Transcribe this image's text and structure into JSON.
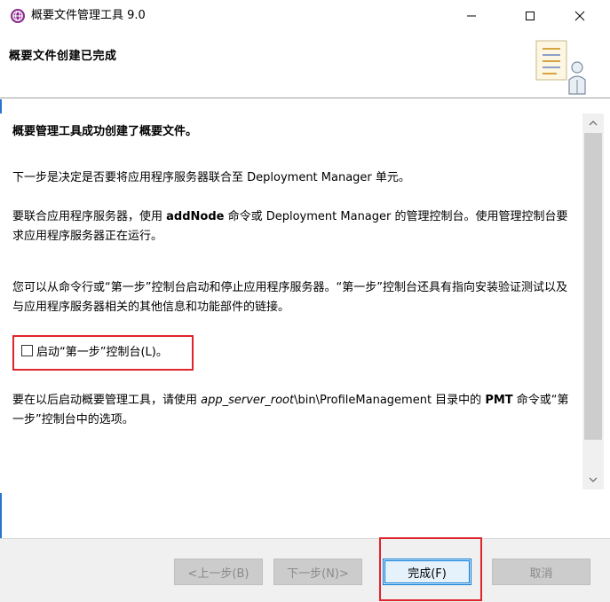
{
  "window": {
    "title": "概要文件管理工具 9.0"
  },
  "header": {
    "title": "概要文件创建已完成",
    "graphic_icon": "document-with-person-icon"
  },
  "content": {
    "heading": "概要管理工具成功创建了概要文件。",
    "p1": "下一步是决定是否要将应用程序服务器联合至 Deployment Manager 单元。",
    "p2_before": " 要联合应用程序服务器，使用 ",
    "p2_bold": "addNode",
    "p2_after": " 命令或 Deployment Manager 的管理控制台。使用管理控制台要求应用程序服务器正在运行。",
    "p3": "您可以从命令行或“第一步”控制台启动和停止应用程序服务器。“第一步”控制台还具有指向安装验证测试以及与应用程序服务器相关的其他信息和功能部件的链接。",
    "checkbox_label": "启动“第一步”控制台(L)。",
    "checkbox_checked": false,
    "p4_before": "要在以后启动概要管理工具，请使用 ",
    "p4_italic": "app_server_root",
    "p4_after": "\\bin\\ProfileManagement 目录中的 ",
    "p4_bold": "PMT",
    "p4_end": " 命令或“第一步”控制台中的选项。"
  },
  "buttons": {
    "back": "<上一步(B)",
    "next": "下一步(N)>",
    "finish": "完成(F)",
    "cancel": "取消"
  },
  "colors": {
    "highlight": "#e0242b",
    "focus": "#0078d7"
  }
}
